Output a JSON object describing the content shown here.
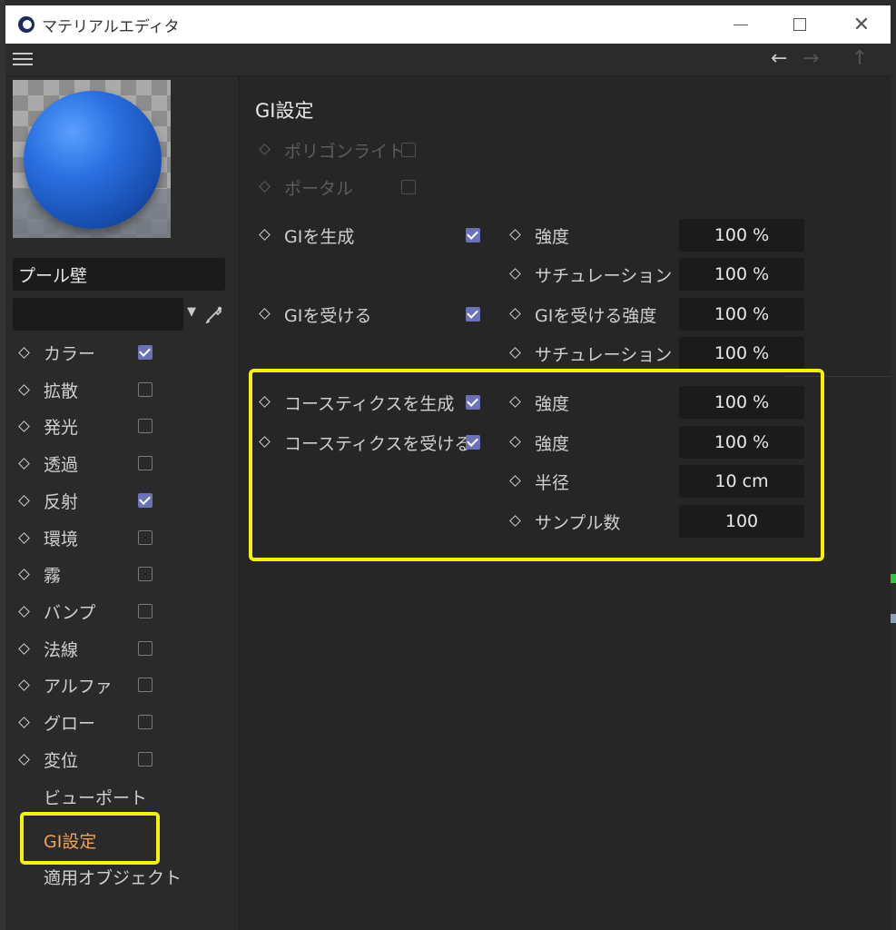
{
  "window": {
    "title": "マテリアルエディタ",
    "controls": {
      "minimize": "—",
      "maximize": "☐",
      "close": "✕"
    }
  },
  "toolbar": {
    "menu_icon": "hamburger-menu-icon",
    "back_icon": "←",
    "forward_icon": "→",
    "up_icon": "↑"
  },
  "material": {
    "name": "プール壁",
    "layer_value": ""
  },
  "channels": [
    {
      "label": "カラー",
      "checked": true
    },
    {
      "label": "拡散",
      "checked": false
    },
    {
      "label": "発光",
      "checked": false
    },
    {
      "label": "透過",
      "checked": false
    },
    {
      "label": "反射",
      "checked": true
    },
    {
      "label": "環境",
      "checked": false
    },
    {
      "label": "霧",
      "checked": false
    },
    {
      "label": "バンプ",
      "checked": false
    },
    {
      "label": "法線",
      "checked": false
    },
    {
      "label": "アルファ",
      "checked": false
    },
    {
      "label": "グロー",
      "checked": false
    },
    {
      "label": "変位",
      "checked": false
    }
  ],
  "extra_items": {
    "viewport": "ビューポート",
    "gi_settings": "GI設定",
    "assigned_objects": "適用オブジェクト"
  },
  "gi_panel": {
    "title": "GI設定",
    "polygon_light": {
      "label": "ポリゴンライト",
      "checked": false,
      "enabled": false
    },
    "portal": {
      "label": "ポータル",
      "checked": false,
      "enabled": false
    },
    "generate_gi": {
      "label": "GIを生成",
      "checked": true
    },
    "receive_gi": {
      "label": "GIを受ける",
      "checked": true
    },
    "generate_caustics": {
      "label": "コースティクスを生成",
      "checked": true
    },
    "receive_caustics": {
      "label": "コースティクスを受ける",
      "checked": true
    },
    "gen_strength": {
      "label": "強度",
      "value": "100 %"
    },
    "gen_saturation": {
      "label": "サチュレーション",
      "value": "100 %"
    },
    "recv_strength": {
      "label": "GIを受ける強度",
      "value": "100 %"
    },
    "recv_saturation": {
      "label": "サチュレーション",
      "value": "100 %"
    },
    "caustics_gen_strength": {
      "label": "強度",
      "value": "100 %"
    },
    "caustics_recv_strength": {
      "label": "強度",
      "value": "100 %"
    },
    "radius": {
      "label": "半径",
      "value": "10 cm"
    },
    "samples": {
      "label": "サンプル数",
      "value": "100"
    }
  },
  "colors": {
    "highlight": "#f5ef18",
    "active_item": "#f0a15a",
    "checkbox_on": "#6b72b8",
    "sphere": "#2a6fe0"
  }
}
